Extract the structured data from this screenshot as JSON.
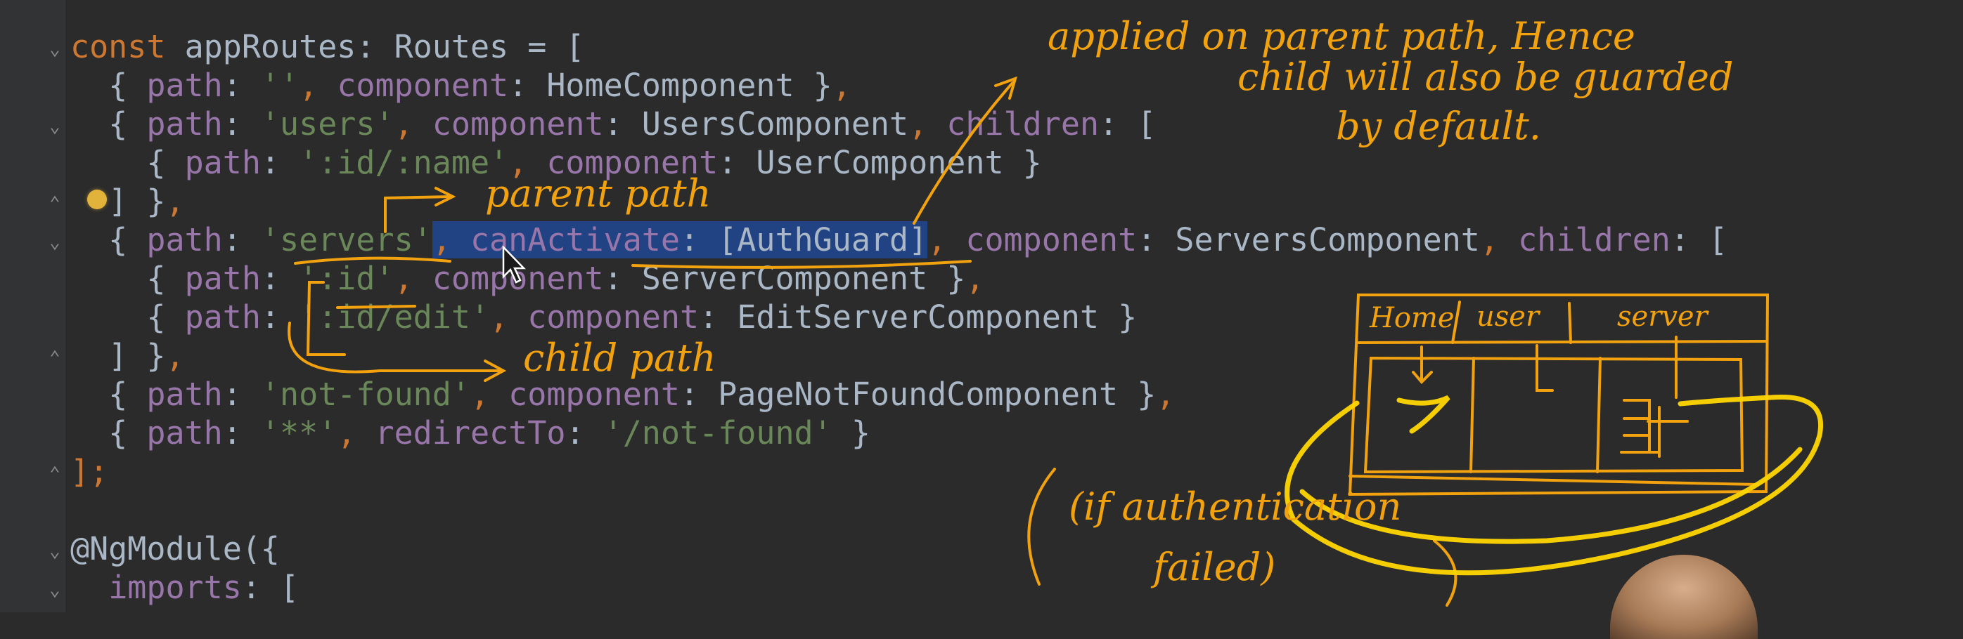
{
  "editor": {
    "lines": [
      {
        "segments": [
          {
            "t": "const ",
            "c": "k"
          },
          {
            "t": "appRoutes: Routes = [",
            "c": ""
          }
        ]
      },
      {
        "segments": [
          {
            "t": "  { ",
            "c": ""
          },
          {
            "t": "path",
            "c": "p"
          },
          {
            "t": ": ",
            "c": ""
          },
          {
            "t": "''",
            "c": "s"
          },
          {
            "t": ", ",
            "c": "k"
          },
          {
            "t": "component",
            "c": "p"
          },
          {
            "t": ": HomeComponent }",
            "c": ""
          },
          {
            "t": ",",
            "c": "k"
          }
        ]
      },
      {
        "segments": [
          {
            "t": "  { ",
            "c": ""
          },
          {
            "t": "path",
            "c": "p"
          },
          {
            "t": ": ",
            "c": ""
          },
          {
            "t": "'users'",
            "c": "s"
          },
          {
            "t": ", ",
            "c": "k"
          },
          {
            "t": "component",
            "c": "p"
          },
          {
            "t": ": UsersComponent",
            "c": ""
          },
          {
            "t": ", ",
            "c": "k"
          },
          {
            "t": "children",
            "c": "p"
          },
          {
            "t": ": [",
            "c": ""
          }
        ]
      },
      {
        "segments": [
          {
            "t": "    { ",
            "c": ""
          },
          {
            "t": "path",
            "c": "p"
          },
          {
            "t": ": ",
            "c": ""
          },
          {
            "t": "':id/:name'",
            "c": "s"
          },
          {
            "t": ", ",
            "c": "k"
          },
          {
            "t": "component",
            "c": "p"
          },
          {
            "t": ": UserComponent }",
            "c": ""
          }
        ]
      },
      {
        "segments": [
          {
            "t": "  ] }",
            "c": ""
          },
          {
            "t": ",",
            "c": "k"
          }
        ]
      },
      {
        "segments": [
          {
            "t": "  { ",
            "c": ""
          },
          {
            "t": "path",
            "c": "p"
          },
          {
            "t": ": ",
            "c": ""
          },
          {
            "t": "'servers'",
            "c": "s"
          },
          {
            "t": ", ",
            "c": "k sel"
          },
          {
            "t": "canActivate",
            "c": "p sel"
          },
          {
            "t": ": [AuthGuard]",
            "c": "sel"
          },
          {
            "t": ", ",
            "c": "k"
          },
          {
            "t": "component",
            "c": "p"
          },
          {
            "t": ": ServersComponent",
            "c": ""
          },
          {
            "t": ", ",
            "c": "k"
          },
          {
            "t": "children",
            "c": "p"
          },
          {
            "t": ": [",
            "c": ""
          }
        ]
      },
      {
        "segments": [
          {
            "t": "    { ",
            "c": ""
          },
          {
            "t": "path",
            "c": "p"
          },
          {
            "t": ": ",
            "c": ""
          },
          {
            "t": "':id'",
            "c": "s"
          },
          {
            "t": ", ",
            "c": "k"
          },
          {
            "t": "component",
            "c": "p"
          },
          {
            "t": ": ServerComponent }",
            "c": ""
          },
          {
            "t": ",",
            "c": "k"
          }
        ]
      },
      {
        "segments": [
          {
            "t": "    { ",
            "c": ""
          },
          {
            "t": "path",
            "c": "p"
          },
          {
            "t": ": ",
            "c": ""
          },
          {
            "t": "':id/edit'",
            "c": "s"
          },
          {
            "t": ", ",
            "c": "k"
          },
          {
            "t": "component",
            "c": "p"
          },
          {
            "t": ": EditServerComponent }",
            "c": ""
          }
        ]
      },
      {
        "segments": [
          {
            "t": "  ] }",
            "c": ""
          },
          {
            "t": ",",
            "c": "k"
          }
        ]
      },
      {
        "segments": [
          {
            "t": "  { ",
            "c": ""
          },
          {
            "t": "path",
            "c": "p"
          },
          {
            "t": ": ",
            "c": ""
          },
          {
            "t": "'not-found'",
            "c": "s"
          },
          {
            "t": ", ",
            "c": "k"
          },
          {
            "t": "component",
            "c": "p"
          },
          {
            "t": ": PageNotFoundComponent }",
            "c": ""
          },
          {
            "t": ",",
            "c": "k"
          }
        ]
      },
      {
        "segments": [
          {
            "t": "  { ",
            "c": ""
          },
          {
            "t": "path",
            "c": "p"
          },
          {
            "t": ": ",
            "c": ""
          },
          {
            "t": "'**'",
            "c": "s"
          },
          {
            "t": ", ",
            "c": "k"
          },
          {
            "t": "redirectTo",
            "c": "p"
          },
          {
            "t": ": ",
            "c": ""
          },
          {
            "t": "'/not-found'",
            "c": "s"
          },
          {
            "t": " }",
            "c": ""
          }
        ]
      },
      {
        "segments": [
          {
            "t": "];",
            "c": "k"
          }
        ]
      },
      {
        "segments": [
          {
            "t": "",
            "c": ""
          }
        ]
      },
      {
        "segments": [
          {
            "t": "@NgModule({",
            "c": ""
          }
        ]
      },
      {
        "segments": [
          {
            "t": "  ",
            "c": ""
          },
          {
            "t": "imports",
            "c": "p"
          },
          {
            "t": ": [",
            "c": ""
          }
        ]
      }
    ]
  },
  "annotations": {
    "applied": [
      "applied on parent path, Hence",
      "child will also be guarded",
      "by default."
    ],
    "parent_path": "parent path",
    "child_path": "child path",
    "auth_failed": [
      "(if authentication",
      "failed)"
    ],
    "sketch_tabs": [
      "Home",
      "user",
      "server"
    ]
  },
  "colors": {
    "ink": "#f2a20e",
    "highlight": "#ffd600",
    "selection": "#214283"
  }
}
